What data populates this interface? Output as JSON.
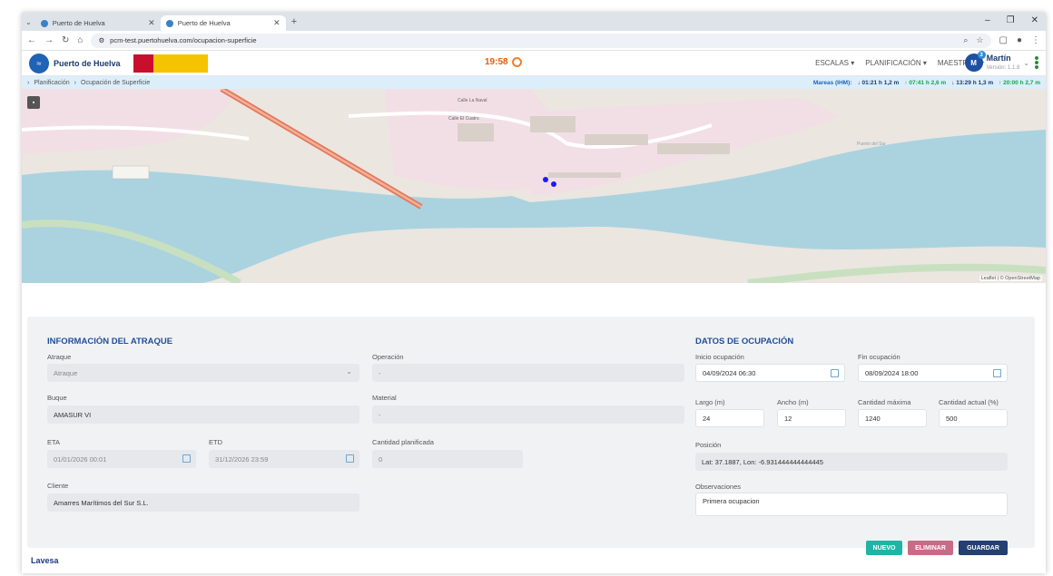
{
  "browser": {
    "tabs": [
      {
        "title": "Puerto de Huelva"
      },
      {
        "title": "Puerto de Huelva"
      }
    ],
    "url": "pcm-test.puertohuelva.com/ocupacion-superficie"
  },
  "header": {
    "brand": "Puerto de Huelva",
    "clock": "19:58",
    "menus": [
      "ESCALAS ▾",
      "PLANIFICACIÓN ▾",
      "MAESTROS ▾"
    ],
    "user": {
      "initial": "M",
      "badge": "3",
      "name": "Martín",
      "version": "Versión: 1.1.8"
    }
  },
  "breadcrumb": {
    "items": [
      "Planificación",
      "Ocupación de Superficie"
    ],
    "tides_label": "Mareas (IHM):",
    "tides": [
      {
        "dir": "down",
        "text": "↓ 01:21 h 1,2 m"
      },
      {
        "dir": "up",
        "text": "↑ 07:41 h 2,6 m"
      },
      {
        "dir": "down",
        "text": "↓ 13:29 h 1,3 m"
      },
      {
        "dir": "up",
        "text": "↑ 20:00 h 2,7 m"
      }
    ]
  },
  "map": {
    "labels": [
      "Calle La Naval",
      "Calle El Cuatro",
      "Puerto del Sur"
    ],
    "attribution": "Leaflet | © OpenStreetMap"
  },
  "atraque": {
    "title": "INFORMACIÓN DEL ATRAQUE",
    "atraque_label": "Atraque",
    "atraque_value": "Atraque",
    "operacion_label": "Operación",
    "operacion_value": "-",
    "buque_label": "Buque",
    "buque_value": "AMASUR VI",
    "material_label": "Material",
    "material_value": "-",
    "eta_label": "ETA",
    "eta_value": "01/01/2026 00:01",
    "etd_label": "ETD",
    "etd_value": "31/12/2026 23:59",
    "cantidad_label": "Cantidad planificada",
    "cantidad_value": "0",
    "cliente_label": "Cliente",
    "cliente_value": "Amarres Marítimos del Sur S.L."
  },
  "ocupacion": {
    "title": "DATOS DE OCUPACIÓN",
    "inicio_label": "Inicio ocupación",
    "inicio_value": "04/09/2024 06:30",
    "fin_label": "Fin ocupación",
    "fin_value": "08/09/2024 18:00",
    "largo_label": "Largo (m)",
    "largo_value": "24",
    "ancho_label": "Ancho (m)",
    "ancho_value": "12",
    "cmax_label": "Cantidad máxima",
    "cmax_value": "1240",
    "cact_label": "Cantidad actual (%)",
    "cact_value": "500",
    "posicion_label": "Posición",
    "posicion_value": "Lat: 37.1887, Lon: -6.931444444444445",
    "obs_label": "Observaciones",
    "obs_value": "Primera ocupacion"
  },
  "actions": {
    "nuevo": "NUEVO",
    "eliminar": "ELIMINAR",
    "guardar": "GUARDAR"
  },
  "footer": {
    "logo": "Lavesa"
  },
  "colors": {
    "accent": "#1f4f9a",
    "nuevo": "#1fb5a6",
    "eliminar": "#c86b86",
    "guardar": "#243f72",
    "water": "#aad3df"
  }
}
